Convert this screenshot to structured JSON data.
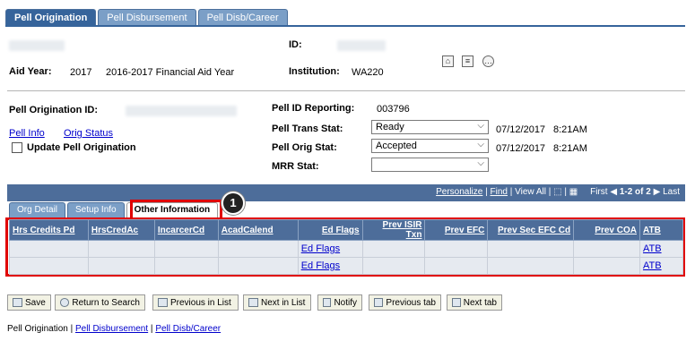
{
  "tabs": {
    "t1": "Pell Origination",
    "t2": "Pell Disbursement",
    "t3": "Pell Disb/Career"
  },
  "header": {
    "id_label": "ID:",
    "aid_year_label": "Aid Year:",
    "aid_year": "2017",
    "aid_year_desc": "2016-2017 Financial Aid Year",
    "institution_label": "Institution:",
    "institution": "WA220"
  },
  "orig": {
    "orig_id_label": "Pell Origination ID:",
    "pell_info": "Pell Info",
    "orig_status": "Orig Status",
    "update_label": "Update Pell Origination",
    "id_reporting_label": "Pell ID Reporting:",
    "id_reporting": "003796",
    "trans_stat_label": "Pell Trans Stat:",
    "trans_stat": "Ready",
    "trans_date": "07/12/2017",
    "trans_time": "8:21AM",
    "orig_stat_label": "Pell Orig Stat:",
    "orig_stat": "Accepted",
    "orig_date": "07/12/2017",
    "orig_time": "8:21AM",
    "mrr_label": "MRR Stat:",
    "mrr_value": ""
  },
  "grid": {
    "personalize": "Personalize",
    "find": "Find",
    "view_all": "View All",
    "first": "First",
    "range": "1-2 of 2",
    "last": "Last",
    "subtabs": [
      "Org Detail",
      "Setup Info",
      "Other Information"
    ],
    "badge": "1",
    "columns": [
      "Hrs Credits Pd",
      "HrsCredAc",
      "IncarcerCd",
      "AcadCalend",
      "Ed Flags",
      "Prev ISIR Txn",
      "Prev EFC",
      "Prev Sec EFC Cd",
      "Prev COA",
      "ATB"
    ],
    "rows": [
      {
        "ed_flags": "Ed Flags",
        "atb": "ATB"
      },
      {
        "ed_flags": "Ed Flags",
        "atb": "ATB"
      }
    ]
  },
  "toolbar": {
    "save": "Save",
    "return": "Return to Search",
    "prev_list": "Previous in List",
    "next_list": "Next in List",
    "notify": "Notify",
    "prev_tab": "Previous tab",
    "next_tab": "Next tab"
  },
  "footer": {
    "l1": "Pell Origination",
    "l2": "Pell Disbursement",
    "l3": "Pell Disb/Career",
    "sep": "|"
  },
  "colors": {
    "tab_active": "#36649b",
    "highlight": "#e00000",
    "link": "#0000cc"
  }
}
